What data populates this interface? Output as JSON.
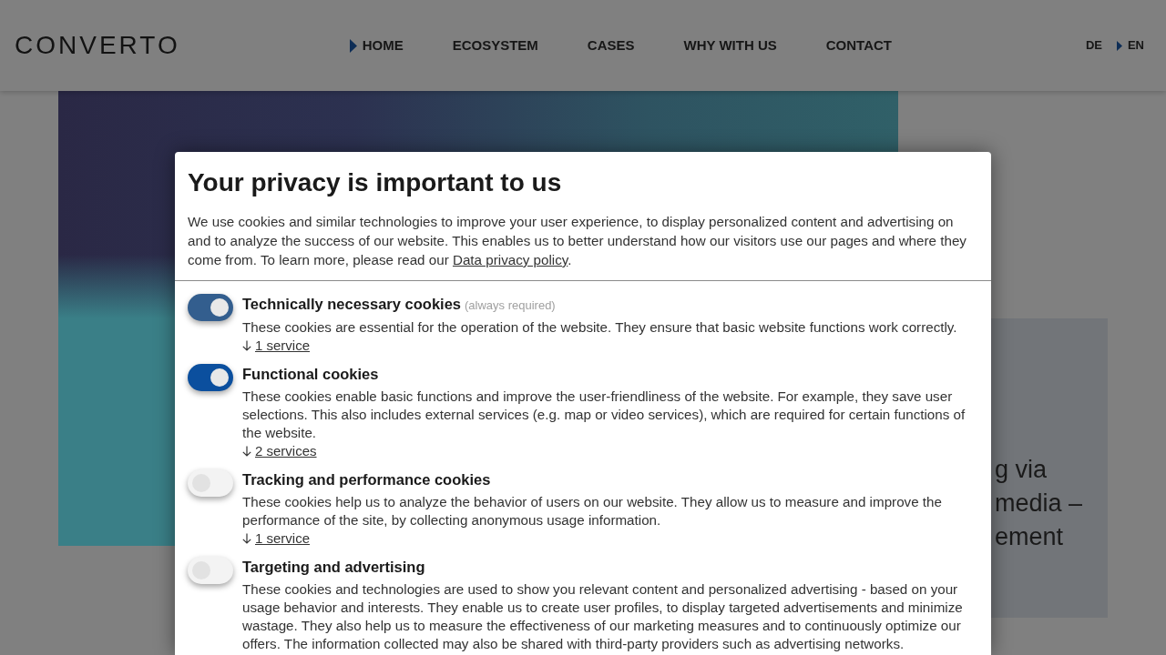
{
  "header": {
    "logo": "CONVERTO",
    "nav": [
      {
        "label": "HOME",
        "selected": true
      },
      {
        "label": "ECOSYSTEM",
        "selected": false
      },
      {
        "label": "CASES",
        "selected": false
      },
      {
        "label": "WHY WITH US",
        "selected": false
      },
      {
        "label": "CONTACT",
        "selected": false
      }
    ],
    "languages": [
      {
        "label": "DE",
        "selected": false
      },
      {
        "label": "EN",
        "selected": true
      }
    ]
  },
  "teaser_panel": {
    "heading_lines": [
      "g via",
      "media –",
      "ement"
    ]
  },
  "consent_dialog": {
    "title": "Your privacy is important to us",
    "intro": {
      "text": "We use cookies and similar technologies to improve your user experience, to display personalized content and advertising on and to analyze the success of our website. This enables us to better understand how our visitors use our pages and where they come from. To learn more, please read our",
      "link": "Data privacy policy",
      "after_link": "."
    },
    "categories": [
      {
        "title": "Technically necessary cookies",
        "note": "(always required)",
        "description": "These cookies are essential for the operation of the website. They ensure that basic website functions work correctly.",
        "services": "1 service",
        "on": true,
        "disabled": true
      },
      {
        "title": "Functional cookies",
        "description": "These cookies enable basic functions and improve the user-friendliness of the website. For example, they save user selections. This also includes external services (e.g. map or video services), which are required for certain functions of the website.",
        "services": "2 services",
        "on": true,
        "disabled": false
      },
      {
        "title": "Tracking and performance cookies",
        "description": "These cookies help us to analyze the behavior of users on our website. They allow us to measure and improve the performance of the site, by collecting anonymous usage information.",
        "services": "1 service",
        "on": false,
        "disabled": false
      },
      {
        "title": "Targeting and advertising",
        "description": "These cookies and technologies are used to show you relevant content and personalized advertising - based on your usage behavior and interests. They enable us to create user profiles, to display targeted advertisements and minimize wastage. They also help us to measure the effectiveness of our marketing measures and to continuously optimize our offers. The information collected may also be shared with third-party providers such as advertising networks.",
        "on": false,
        "disabled": false
      }
    ]
  }
}
